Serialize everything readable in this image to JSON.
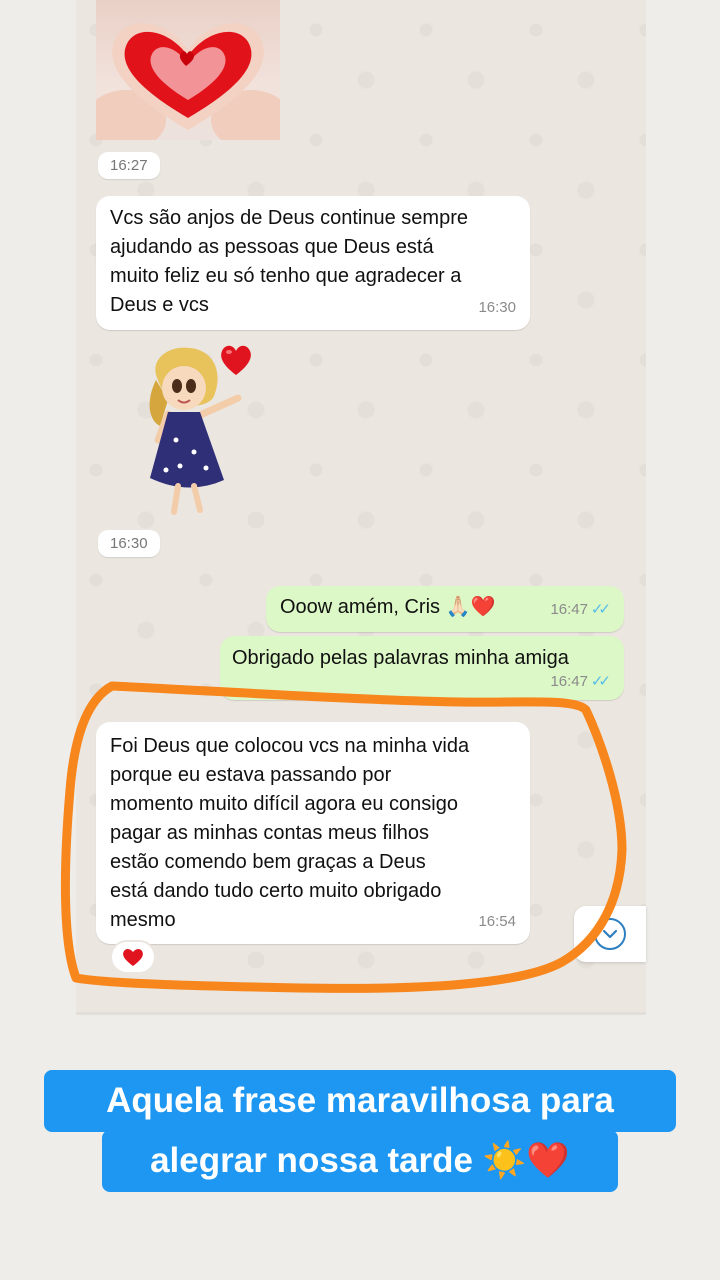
{
  "chat": {
    "sticker1_time": "16:27",
    "msg1": {
      "text": "Vcs são anjos de Deus continue sempre\najudando as pessoas que Deus está\nmuito feliz eu só tenho que agradecer a\nDeus e vcs",
      "time": "16:30"
    },
    "sticker2_time": "16:30",
    "msg2": {
      "text": "Ooow amém, Cris 🙏🏻❤️",
      "time": "16:47",
      "ticks": "✓✓"
    },
    "msg3": {
      "text": "Obrigado pelas palavras minha amiga",
      "time": "16:47",
      "ticks": "✓✓"
    },
    "msg4": {
      "text": "Foi Deus que colocou vcs na minha vida\nporque eu estava passando por\nmomento muito difícil agora eu consigo\npagar as minhas contas meus filhos\nestão comendo bem graças a Deus\nestá dando tudo certo muito obrigado\nmesmo",
      "time": "16:54",
      "reaction": "❤️"
    }
  },
  "caption": {
    "line1": "Aquela frase maravilhosa para",
    "line2": "alegrar nossa tarde ☀️❤️"
  },
  "colors": {
    "incoming_bubble": "#ffffff",
    "outgoing_bubble": "#dcf8c6",
    "read_ticks": "#53bdeb",
    "highlight_outline": "#f7861d",
    "caption_background": "#1d97f2"
  },
  "icons": {
    "scroll_down": "chevron-down-icon",
    "reaction": "heart-icon"
  }
}
